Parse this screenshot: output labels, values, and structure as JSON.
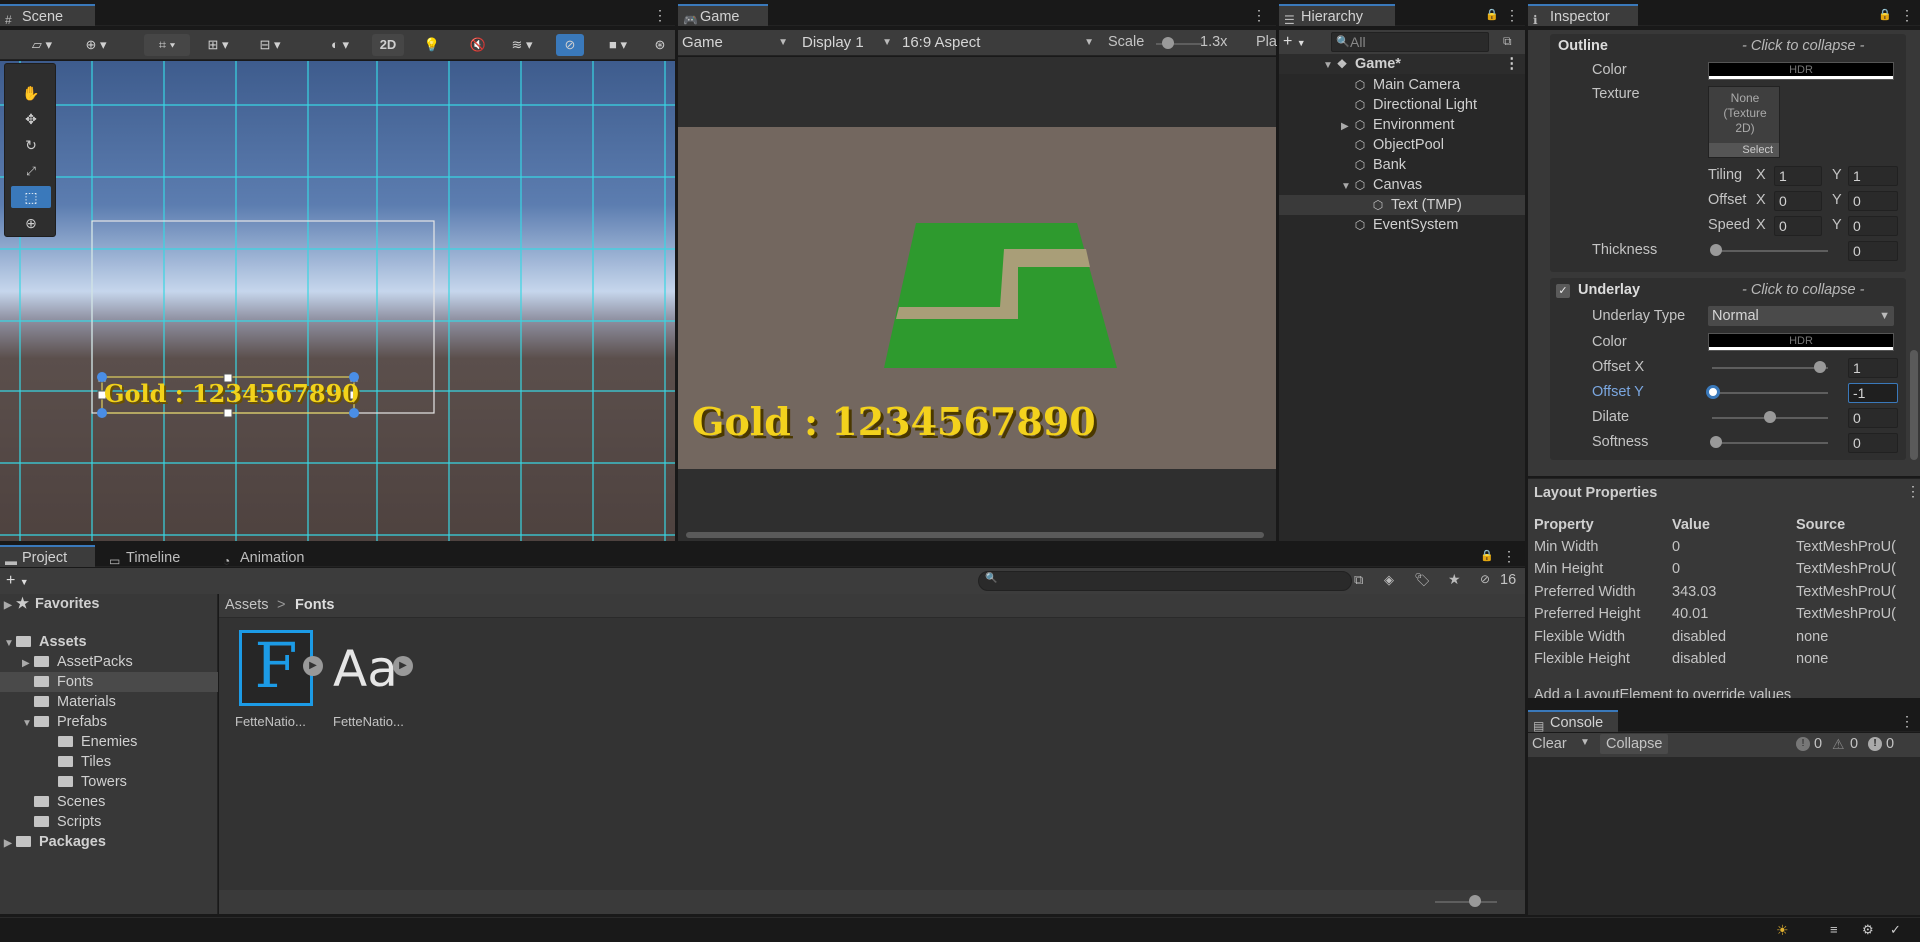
{
  "scene": {
    "tab_label": "Scene",
    "mode_2d": "2D",
    "overlay_text": "Gold : 1234567890"
  },
  "game": {
    "tab_label": "Game",
    "view_select": "Game",
    "display_select": "Display 1",
    "aspect_select": "16:9 Aspect",
    "scale_label": "Scale",
    "scale_value": "1.3x",
    "play_label": "Pla",
    "overlay_text": "Gold : 1234567890"
  },
  "hierarchy": {
    "tab_label": "Hierarchy",
    "search_placeholder": "All",
    "root": "Game*",
    "items": [
      {
        "label": "Main Camera"
      },
      {
        "label": "Directional Light"
      },
      {
        "label": "Environment"
      },
      {
        "label": "ObjectPool"
      },
      {
        "label": "Bank"
      },
      {
        "label": "Canvas"
      },
      {
        "label": "Text (TMP)"
      },
      {
        "label": "EventSystem"
      }
    ]
  },
  "inspector": {
    "tab_label": "Inspector",
    "outline": {
      "title": "Outline",
      "collapse_hint": "- Click to collapse -",
      "color_label": "Color",
      "hdr": "HDR",
      "texture_label": "Texture",
      "texture_value": "None (Texture 2D)",
      "select_label": "Select",
      "tiling_label": "Tiling",
      "offset_label": "Offset",
      "speed_label": "Speed",
      "x": "X",
      "y": "Y",
      "tiling_x": "1",
      "tiling_y": "1",
      "offset_x": "0",
      "offset_y": "0",
      "speed_x": "0",
      "speed_y": "0",
      "thickness_label": "Thickness",
      "thickness_value": "0"
    },
    "underlay": {
      "title": "Underlay",
      "collapse_hint": "- Click to collapse -",
      "type_label": "Underlay Type",
      "type_value": "Normal",
      "color_label": "Color",
      "hdr": "HDR",
      "offset_x_label": "Offset X",
      "offset_x_value": "1",
      "offset_y_label": "Offset Y",
      "offset_y_value": "-1",
      "dilate_label": "Dilate",
      "dilate_value": "0",
      "softness_label": "Softness",
      "softness_value": "0"
    },
    "layout": {
      "title": "Layout Properties",
      "headers": [
        "Property",
        "Value",
        "Source"
      ],
      "rows": [
        [
          "Min Width",
          "0",
          "TextMeshProU("
        ],
        [
          "Min Height",
          "0",
          "TextMeshProU("
        ],
        [
          "Preferred Width",
          "343.03",
          "TextMeshProU("
        ],
        [
          "Preferred Height",
          "40.01",
          "TextMeshProU("
        ],
        [
          "Flexible Width",
          "disabled",
          "none"
        ],
        [
          "Flexible Height",
          "disabled",
          "none"
        ]
      ],
      "footer": "Add a LayoutElement to override values"
    }
  },
  "console": {
    "tab_label": "Console",
    "clear": "Clear",
    "collapse": "Collapse",
    "info_count": "0",
    "warn_count": "0",
    "error_count": "0"
  },
  "project": {
    "tabs": [
      "Project",
      "Timeline",
      "Animation"
    ],
    "hidden_count": "16",
    "breadcrumb_root": "Assets",
    "breadcrumb_sep": ">",
    "breadcrumb_current": "Fonts",
    "tree": [
      {
        "label": "Favorites"
      },
      {
        "label": "Assets"
      },
      {
        "label": "AssetPacks"
      },
      {
        "label": "Fonts"
      },
      {
        "label": "Materials"
      },
      {
        "label": "Prefabs"
      },
      {
        "label": "Enemies"
      },
      {
        "label": "Tiles"
      },
      {
        "label": "Towers"
      },
      {
        "label": "Scenes"
      },
      {
        "label": "Scripts"
      },
      {
        "label": "Packages"
      }
    ],
    "assets": [
      {
        "glyph": "F",
        "label": "FetteNatio..."
      },
      {
        "glyph": "Aa",
        "label": "FetteNatio..."
      }
    ]
  }
}
